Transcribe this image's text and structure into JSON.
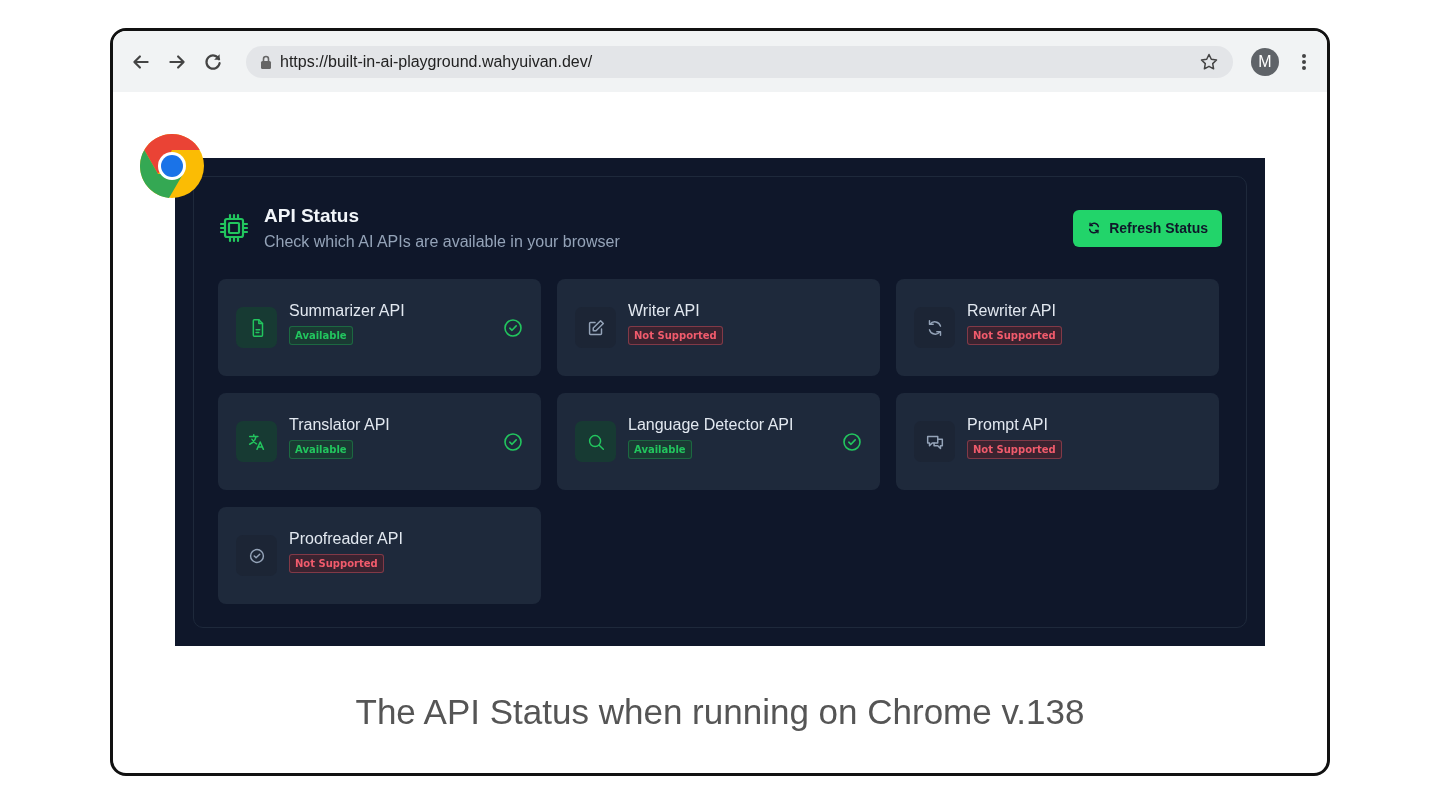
{
  "browser": {
    "url": "https://built-in-ai-playground.wahyuivan.dev/",
    "profile_initial": "M"
  },
  "panel": {
    "title": "API Status",
    "subtitle": "Check which AI APIs are available in your browser",
    "refresh_button": "Refresh Status",
    "apis": [
      {
        "name": "Summarizer API",
        "badge": "Available",
        "available": true
      },
      {
        "name": "Writer API",
        "badge": "Not Supported",
        "available": false
      },
      {
        "name": "Rewriter API",
        "badge": "Not Supported",
        "available": false
      },
      {
        "name": "Translator API",
        "badge": "Available",
        "available": true
      },
      {
        "name": "Language Detector API",
        "badge": "Available",
        "available": true
      },
      {
        "name": "Prompt API",
        "badge": "Not Supported",
        "available": false
      },
      {
        "name": "Proofreader API",
        "badge": "Not Supported",
        "available": false
      }
    ]
  },
  "caption": "The API Status when running on Chrome v.138"
}
